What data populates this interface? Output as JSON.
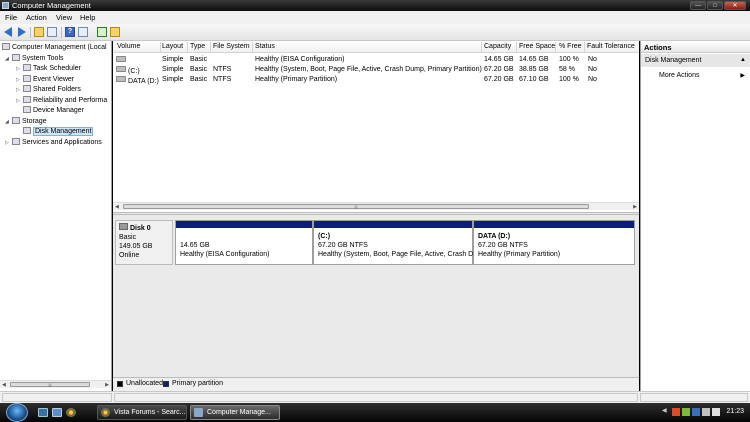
{
  "window": {
    "title": "Computer Management",
    "buttons": [
      "—",
      "□",
      "✕"
    ]
  },
  "menu": {
    "file": "File",
    "action": "Action",
    "view": "View",
    "help": "Help"
  },
  "toolbar": {
    "help_glyph": "?"
  },
  "tree": {
    "root": "Computer Management (Local",
    "system_tools": "System Tools",
    "task_scheduler": "Task Scheduler",
    "event_viewer": "Event Viewer",
    "shared_folders": "Shared Folders",
    "reliability": "Reliability and Performa",
    "device_manager": "Device Manager",
    "storage": "Storage",
    "disk_management": "Disk Management",
    "services": "Services and Applications"
  },
  "volume_table": {
    "headers": [
      "Volume",
      "Layout",
      "Type",
      "File System",
      "Status",
      "Capacity",
      "Free Space",
      "% Free",
      "Fault Tolerance"
    ],
    "rows": [
      {
        "volume": "",
        "layout": "Simple",
        "type": "Basic",
        "fs": "",
        "status": "Healthy (EISA Configuration)",
        "capacity": "14.65 GB",
        "free": "14.65 GB",
        "pct": "100 %",
        "fault": "No"
      },
      {
        "volume": "(C:)",
        "layout": "Simple",
        "type": "Basic",
        "fs": "NTFS",
        "status": "Healthy (System, Boot, Page File, Active, Crash Dump, Primary Partition)",
        "capacity": "67.20 GB",
        "free": "38.85 GB",
        "pct": "58 %",
        "fault": "No"
      },
      {
        "volume": "DATA (D:)",
        "layout": "Simple",
        "type": "Basic",
        "fs": "NTFS",
        "status": "Healthy (Primary Partition)",
        "capacity": "67.20 GB",
        "free": "67.10 GB",
        "pct": "100 %",
        "fault": "No"
      }
    ]
  },
  "disk": {
    "name": "Disk 0",
    "type": "Basic",
    "size": "149.05 GB",
    "state": "Online",
    "partitions": [
      {
        "name": "",
        "size": "14.65 GB",
        "status": "Healthy (EISA Configuration)"
      },
      {
        "name": "(C:)",
        "size": "67.20 GB NTFS",
        "status": "Healthy (System, Boot, Page File, Active, Crash D"
      },
      {
        "name": "DATA  (D:)",
        "size": "67.20 GB NTFS",
        "status": "Healthy (Primary Partition)"
      }
    ]
  },
  "legend": {
    "unallocated": "Unallocated",
    "primary": "Primary partition",
    "unallocated_color": "#000000",
    "primary_color": "#0a1f7a"
  },
  "actions": {
    "header": "Actions",
    "section": "Disk Management",
    "more": "More Actions"
  },
  "taskbar": {
    "tasks": [
      {
        "label": "Vista Forums - Searc..."
      },
      {
        "label": "Computer Manage..."
      }
    ],
    "clock": "21:23"
  }
}
